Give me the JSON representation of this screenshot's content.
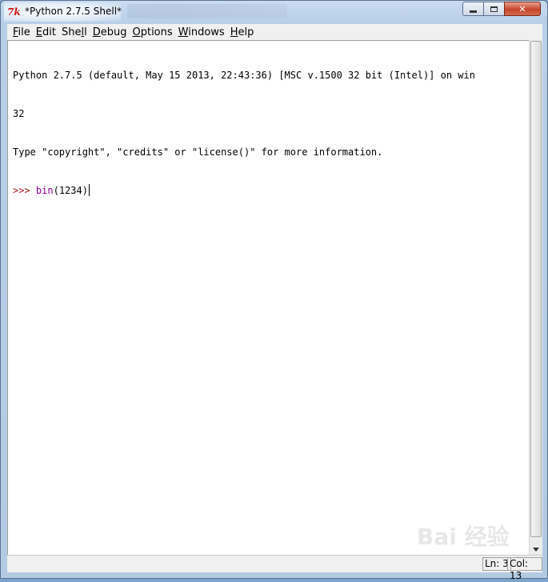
{
  "window": {
    "title": "*Python 2.7.5 Shell*",
    "controls": {
      "minimize": "minimize",
      "maximize": "maximize",
      "close": "✕"
    }
  },
  "menu": {
    "items": [
      {
        "label": "File",
        "underline": "F",
        "rest": "ile"
      },
      {
        "label": "Edit",
        "underline": "E",
        "rest": "dit"
      },
      {
        "label": "Shell",
        "pre": "She",
        "underline": "l",
        "rest": "l"
      },
      {
        "label": "Debug",
        "underline": "D",
        "rest": "ebug"
      },
      {
        "label": "Options",
        "underline": "O",
        "rest": "ptions"
      },
      {
        "label": "Windows",
        "underline": "W",
        "rest": "indows"
      },
      {
        "label": "Help",
        "underline": "H",
        "rest": "elp"
      }
    ]
  },
  "shell": {
    "line1": "Python 2.7.5 (default, May 15 2013, 22:43:36) [MSC v.1500 32 bit (Intel)] on win",
    "line2": "32",
    "line3": "Type \"copyright\", \"credits\" or \"license()\" for more information.",
    "prompt": ">>> ",
    "input_builtin": "bin",
    "input_args": "(1234)"
  },
  "status": {
    "ln": "Ln: 3",
    "col": "Col: 13"
  },
  "watermark": "Bai 经验",
  "colors": {
    "prompt": "#a01818",
    "builtin": "#900090",
    "titlebar": "#b8cfe8"
  }
}
